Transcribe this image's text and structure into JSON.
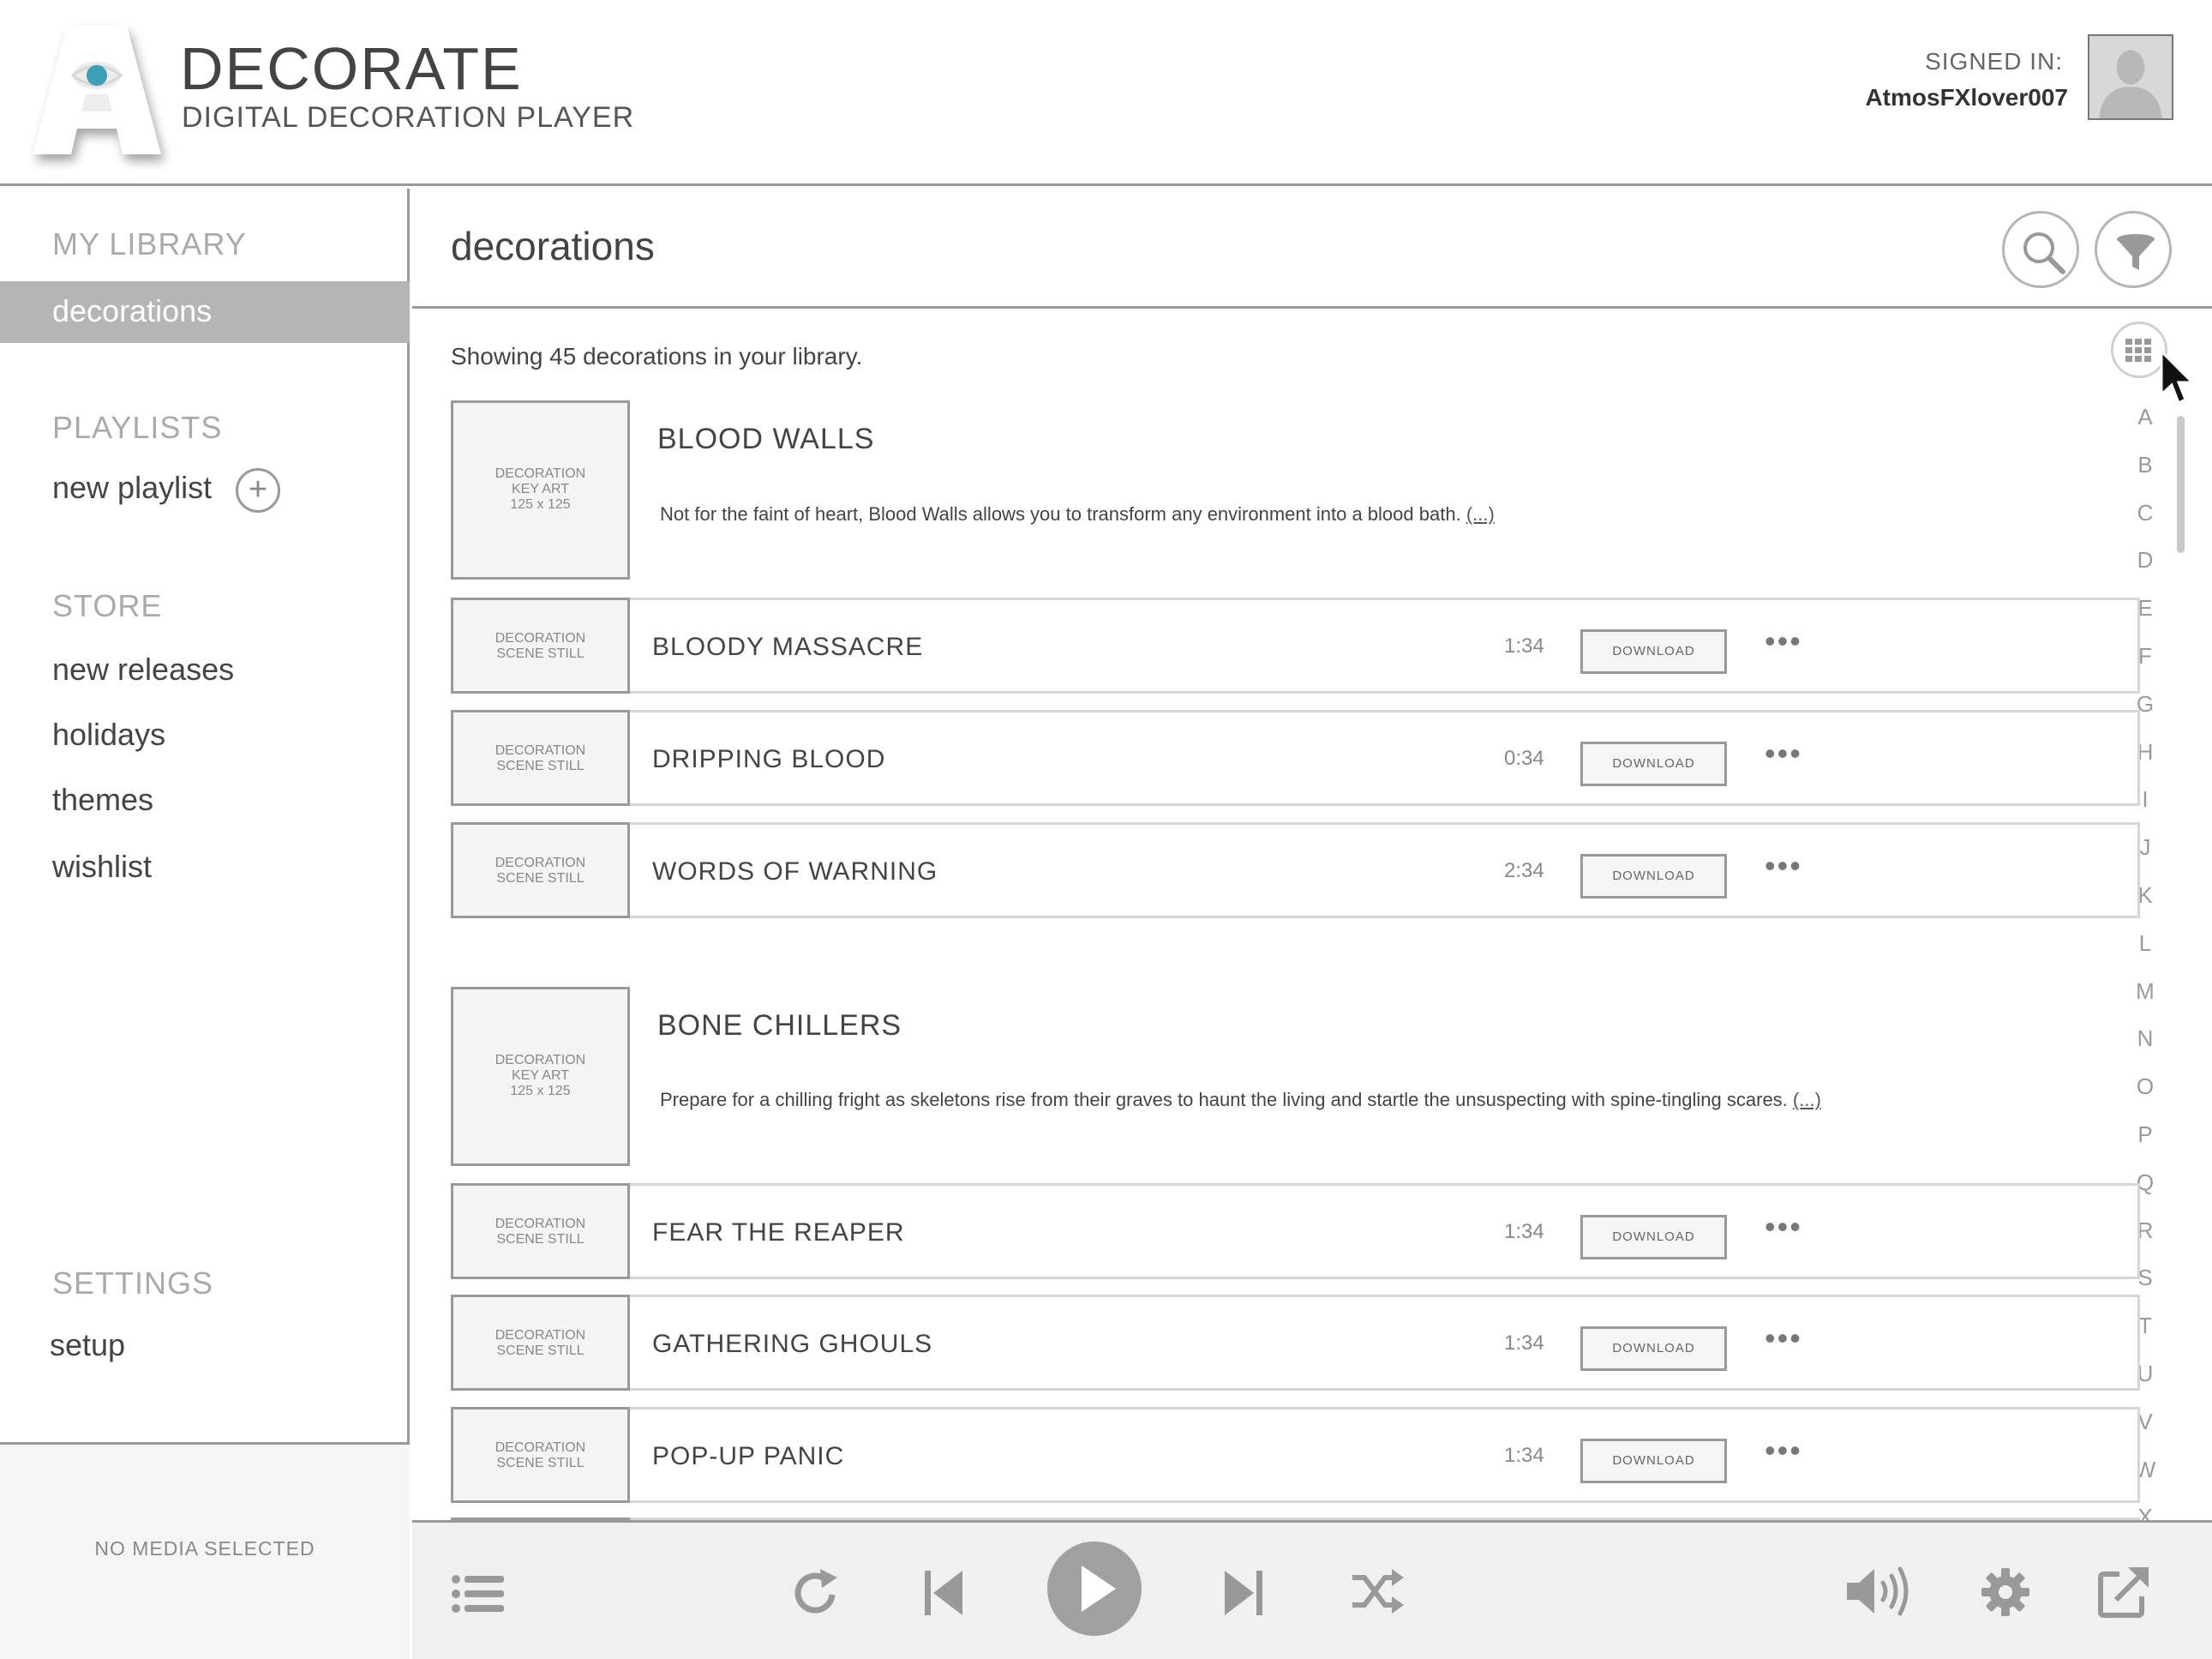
{
  "app": {
    "title": "DECORATE",
    "subtitle": "DIGITAL DECORATION PLAYER"
  },
  "user": {
    "signed_in_label": "SIGNED IN:",
    "username": "AtmosFXlover007"
  },
  "sidebar": {
    "library_heading": "MY LIBRARY",
    "library_items": [
      {
        "label": "decorations",
        "active": true
      }
    ],
    "playlists_heading": "PLAYLISTS",
    "new_playlist_label": "new playlist",
    "store_heading": "STORE",
    "store_items": [
      {
        "label": "new releases"
      },
      {
        "label": "holidays"
      },
      {
        "label": "themes"
      },
      {
        "label": "wishlist"
      }
    ],
    "settings_heading": "SETTINGS",
    "settings_items": [
      {
        "label": "setup"
      }
    ],
    "now_playing": "NO MEDIA SELECTED"
  },
  "main": {
    "title": "decorations",
    "showing_text": "Showing 45 decorations in your library.",
    "alphabet": [
      "A",
      "B",
      "C",
      "D",
      "E",
      "F",
      "G",
      "H",
      "I",
      "J",
      "K",
      "L",
      "M",
      "N",
      "O",
      "P",
      "Q",
      "R",
      "S",
      "T",
      "U",
      "V",
      "W",
      "X"
    ],
    "art_key_label": [
      "DECORATION",
      "KEY ART",
      "125 x 125"
    ],
    "art_still_label": [
      "DECORATION",
      "SCENE STILL"
    ],
    "download_label": "DOWNLOAD",
    "more_label": "•••",
    "more_link": "(...)",
    "groups": [
      {
        "title": "BLOOD WALLS",
        "description": "Not for the faint of heart, Blood Walls allows you to transform any environment into a blood bath.",
        "items": [
          {
            "title": "BLOODY MASSACRE",
            "duration": "1:34"
          },
          {
            "title": "DRIPPING BLOOD",
            "duration": "0:34"
          },
          {
            "title": "WORDS OF WARNING",
            "duration": "2:34"
          }
        ]
      },
      {
        "title": "BONE CHILLERS",
        "description": "Prepare for a chilling fright as skeletons rise from their graves to haunt the living and startle the unsuspecting with spine-tingling scares.",
        "items": [
          {
            "title": "FEAR THE REAPER",
            "duration": "1:34"
          },
          {
            "title": "GATHERING GHOULS",
            "duration": "1:34"
          },
          {
            "title": "POP-UP PANIC",
            "duration": "1:34"
          }
        ]
      }
    ]
  },
  "icons": {
    "logo": "eye-logo-icon",
    "avatar": "user-silhouette-icon",
    "search": "search-icon",
    "filter": "funnel-icon",
    "grid": "grid-view-icon",
    "playlist": "list-icon",
    "repeat": "repeat-icon",
    "previous": "skip-previous-icon",
    "play": "play-icon",
    "next": "skip-next-icon",
    "shuffle": "shuffle-icon",
    "volume": "volume-icon",
    "settings": "gear-icon",
    "external": "external-link-icon"
  },
  "colors": {
    "accent_eye": "#3d9fb8",
    "active_nav": "#b5b5b5",
    "border": "#9a9a9a"
  }
}
